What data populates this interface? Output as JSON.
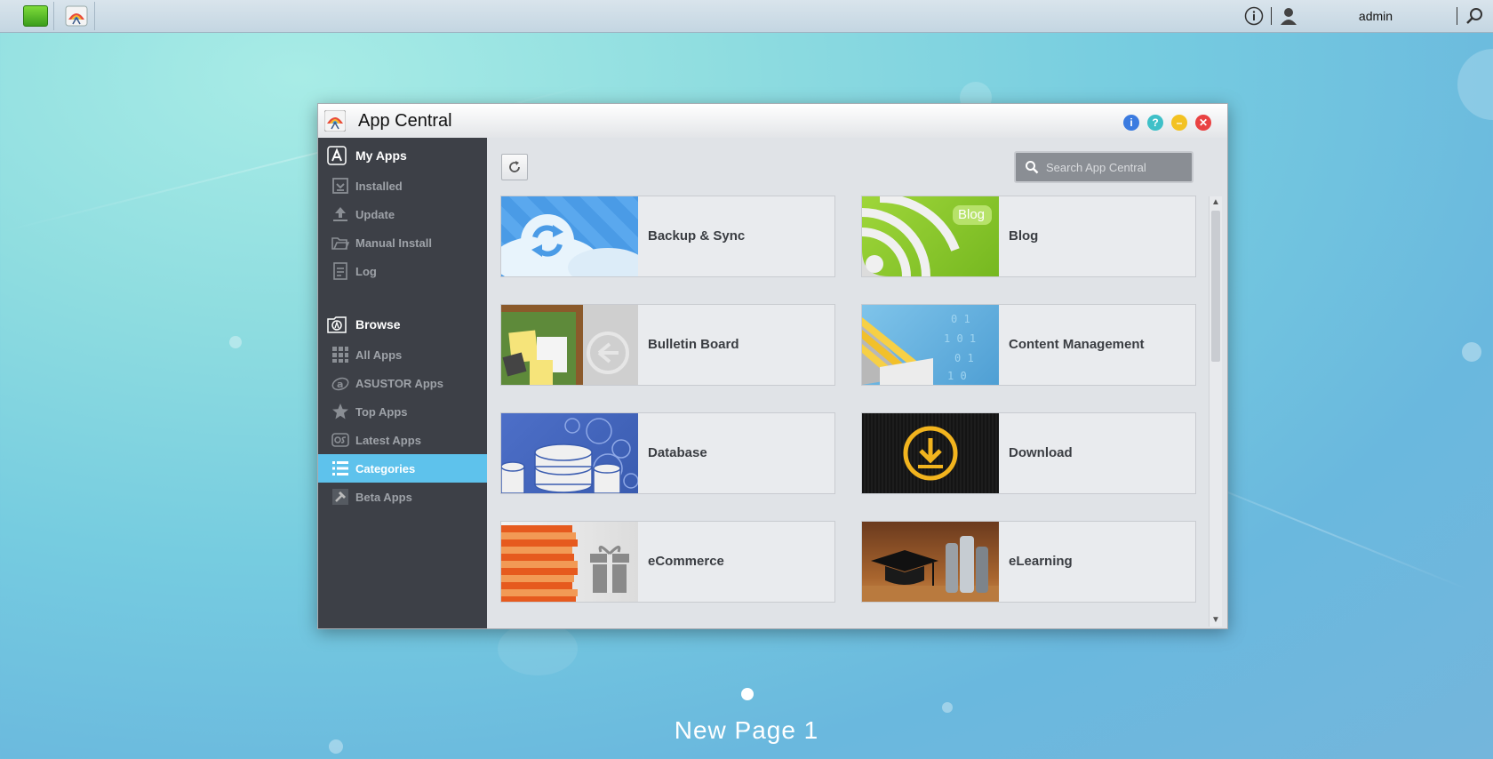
{
  "taskbar": {
    "user": "admin"
  },
  "window": {
    "title": "App Central"
  },
  "sidebar": {
    "my_apps": {
      "label": "My Apps",
      "items": [
        {
          "label": "Installed"
        },
        {
          "label": "Update"
        },
        {
          "label": "Manual Install"
        },
        {
          "label": "Log"
        }
      ]
    },
    "browse": {
      "label": "Browse",
      "items": [
        {
          "label": "All Apps"
        },
        {
          "label": "ASUSTOR Apps"
        },
        {
          "label": "Top Apps"
        },
        {
          "label": "Latest Apps"
        },
        {
          "label": "Categories",
          "active": true
        },
        {
          "label": "Beta Apps"
        }
      ]
    }
  },
  "main": {
    "search_placeholder": "Search App Central",
    "categories": [
      {
        "label": "Backup & Sync"
      },
      {
        "label": "Blog",
        "badge": "Blog"
      },
      {
        "label": "Bulletin Board"
      },
      {
        "label": "Content Management"
      },
      {
        "label": "Database"
      },
      {
        "label": "Download"
      },
      {
        "label": "eCommerce"
      },
      {
        "label": "eLearning"
      }
    ]
  },
  "desktop": {
    "page_label": "New Page 1"
  },
  "colors": {
    "accent": "#5ec2ec",
    "sidebar_bg": "#3d4047"
  }
}
